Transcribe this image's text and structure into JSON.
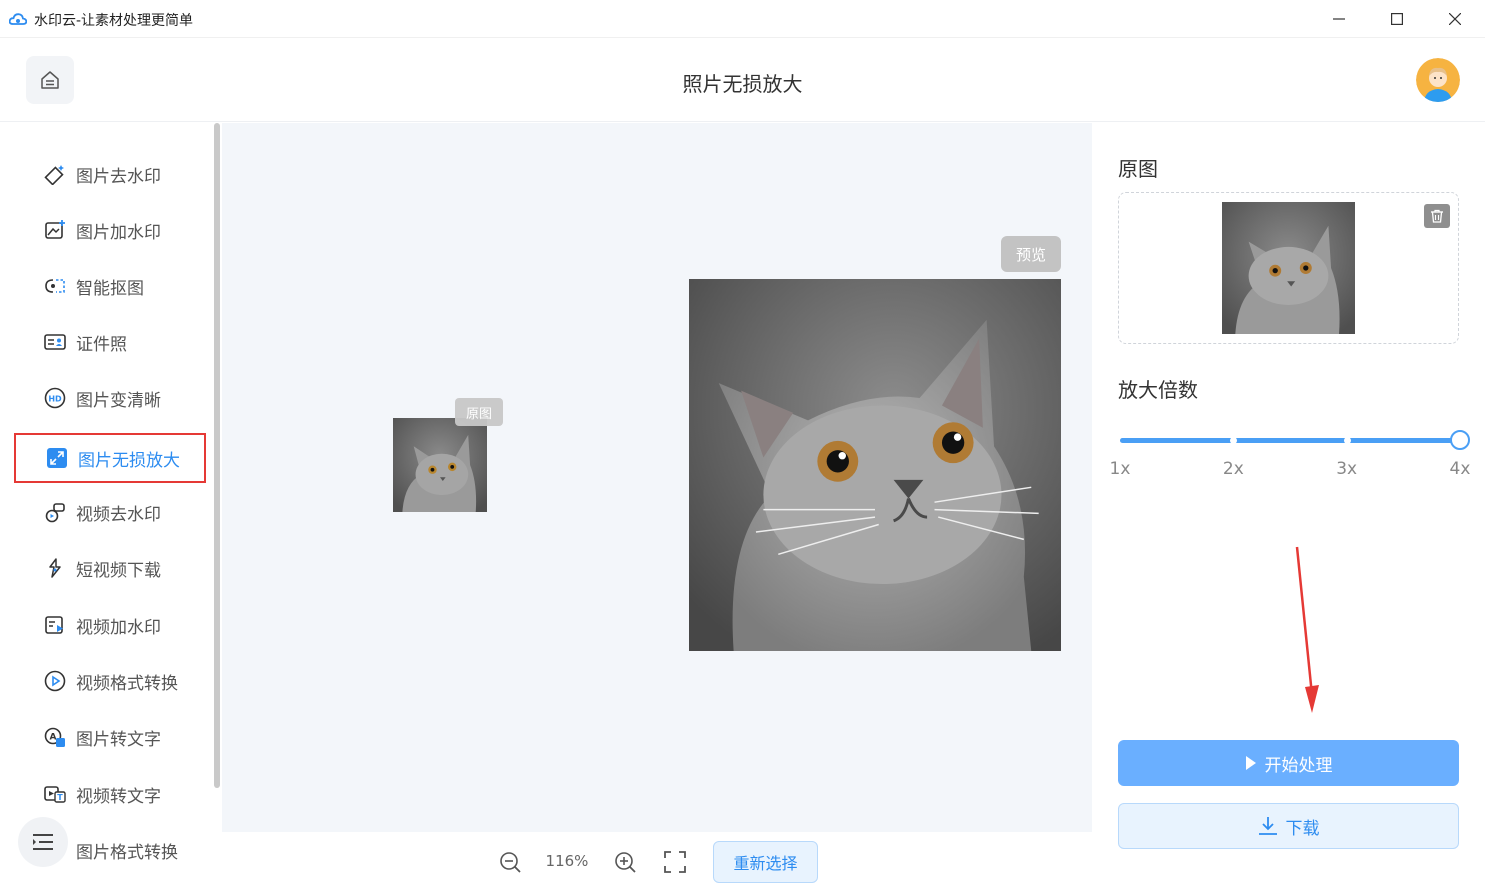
{
  "window": {
    "title": "水印云-让素材处理更简单",
    "minimize_label": "—",
    "maximize_label": "☐",
    "close_label": "✕"
  },
  "header": {
    "page_title": "照片无损放大"
  },
  "sidebar": {
    "items": [
      {
        "label": "图片去水印",
        "icon": "eraser-icon",
        "active": false
      },
      {
        "label": "图片加水印",
        "icon": "image-add-icon",
        "active": false
      },
      {
        "label": "智能抠图",
        "icon": "cutout-icon",
        "active": false
      },
      {
        "label": "证件照",
        "icon": "id-card-icon",
        "active": false
      },
      {
        "label": "图片变清晰",
        "icon": "hd-icon",
        "active": false
      },
      {
        "label": "图片无损放大",
        "icon": "enlarge-icon",
        "active": true
      },
      {
        "label": "视频去水印",
        "icon": "video-eraser-icon",
        "active": false
      },
      {
        "label": "短视频下载",
        "icon": "link-icon",
        "active": false
      },
      {
        "label": "视频加水印",
        "icon": "video-add-icon",
        "active": false
      },
      {
        "label": "视频格式转换",
        "icon": "play-circle-icon",
        "active": false
      },
      {
        "label": "图片转文字",
        "icon": "image-text-icon",
        "active": false
      },
      {
        "label": "视频转文字",
        "icon": "video-text-icon",
        "active": false
      },
      {
        "label": "图片格式转换",
        "icon": "image-convert-icon",
        "active": false
      }
    ]
  },
  "canvas": {
    "original_tag": "原图",
    "preview_tag": "预览"
  },
  "toolbar": {
    "zoom_level": "116%",
    "reselect_label": "重新选择"
  },
  "right_panel": {
    "original_title": "原图",
    "scale_title": "放大倍数",
    "scale_options": [
      "1x",
      "2x",
      "3x",
      "4x"
    ],
    "selected_scale": "4x",
    "start_label": "开始处理",
    "download_label": "下载"
  },
  "colors": {
    "accent": "#2d8cf0",
    "primary_button": "#6aafff",
    "active_border": "#e53935",
    "canvas_bg": "#f3f6fa"
  }
}
